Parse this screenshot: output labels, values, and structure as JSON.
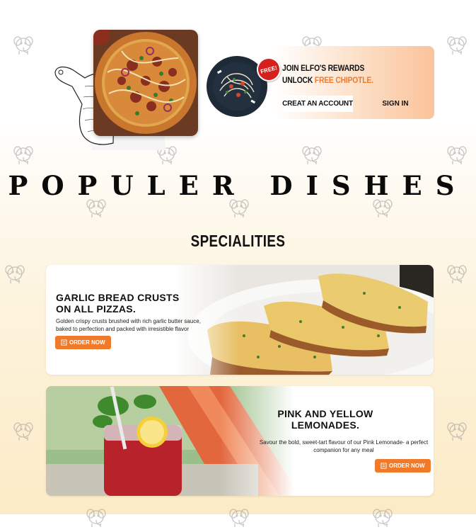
{
  "rewards": {
    "badge": "FREE!",
    "line1": "JOIN ELFO'S REWARDS",
    "line2_prefix": "UNLOCK ",
    "line2_accent": "FREE CHIPOTLE.",
    "create_label": "CREAT AN ACCOUNT",
    "signin_label": "SIGN IN"
  },
  "section": {
    "title": "POPULER DISHES",
    "subtitle": "SPECIALITIES"
  },
  "specials": [
    {
      "title_line1": "GARLIC BREAD CRUSTS",
      "title_line2": "ON ALL PIZZAS.",
      "desc_line1": "Golden crispy crusts brushed with rich garlic butter sauce,",
      "desc_line2": "baked to perfection and packed with irresistible flavor",
      "button": "ORDER NOW"
    },
    {
      "title_line1": "PINK AND YELLOW",
      "title_line2": "LEMONADES.",
      "desc_line1": "Savour the bold, sweet-tart flavour of our Pink Lemonade- a perfect",
      "desc_line2": "companion for any meal",
      "button": "ORDER NOW"
    }
  ],
  "colors": {
    "accent": "#f07a2a",
    "badge": "#d6201d"
  },
  "icons": {
    "mascot": "elephant-mascot-icon",
    "order": "order-list-icon"
  }
}
